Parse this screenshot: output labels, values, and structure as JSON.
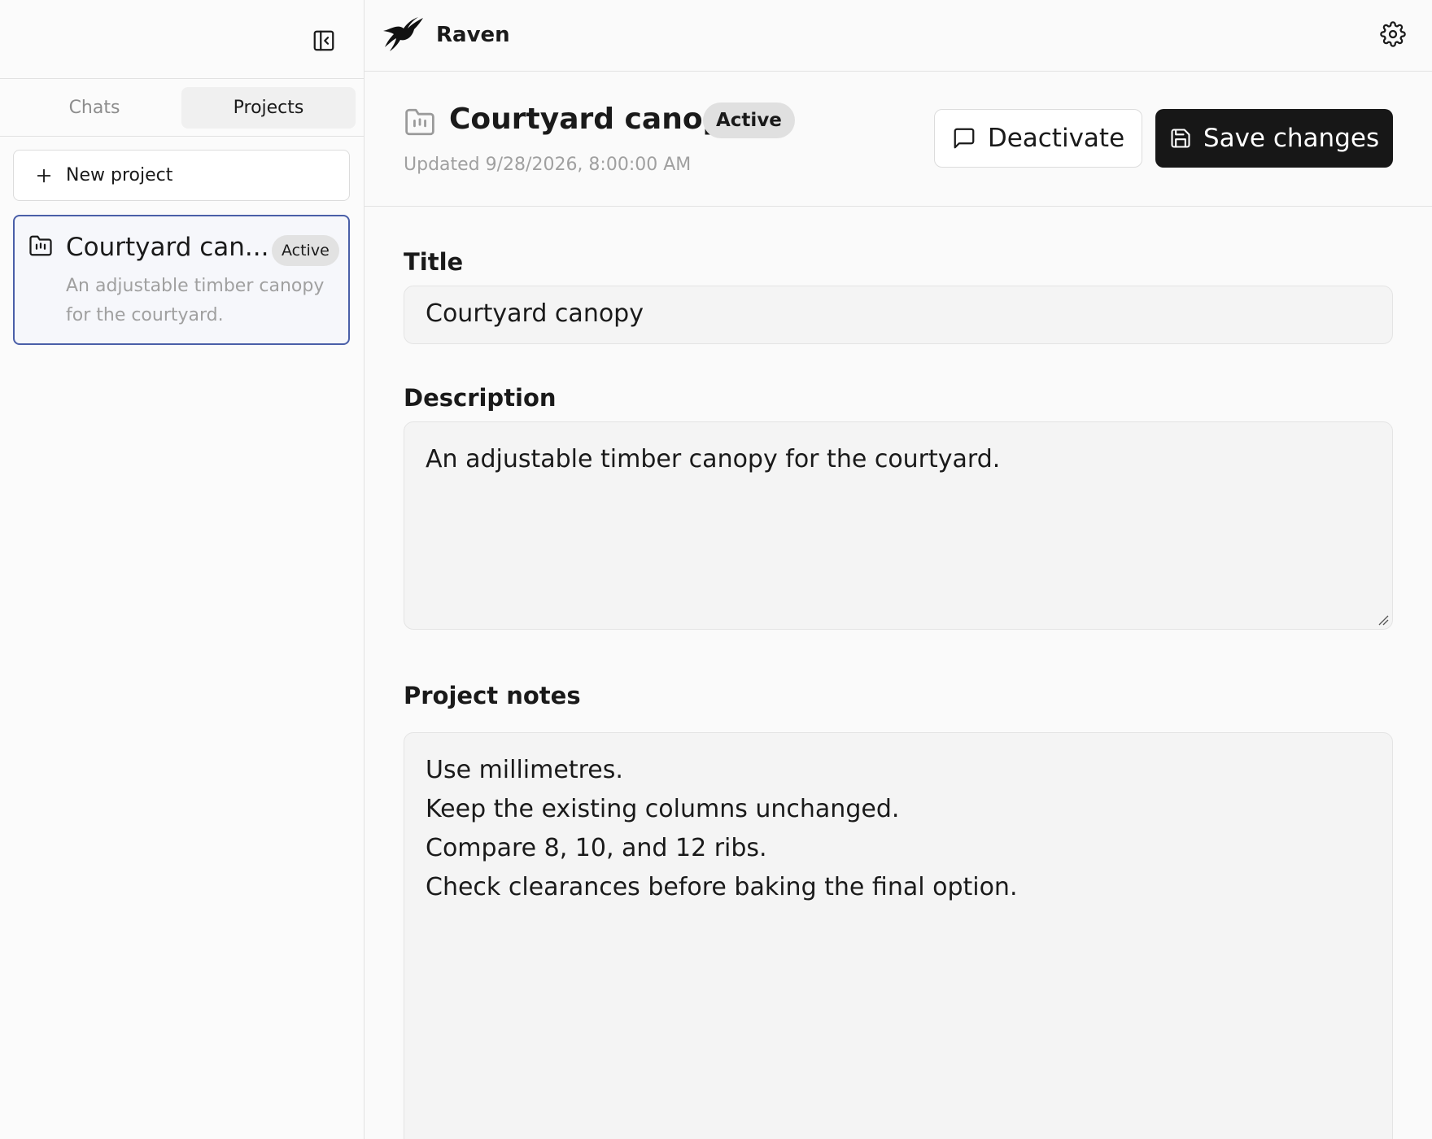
{
  "sidebar": {
    "tabs": [
      {
        "label": "Chats",
        "active": false
      },
      {
        "label": "Projects",
        "active": true
      }
    ],
    "new_project_label": "New project",
    "project": {
      "title": "Courtyard can...",
      "badge": "Active",
      "description": "An adjustable timber canopy for the courtyard."
    }
  },
  "topbar": {
    "brand": "Raven"
  },
  "header": {
    "title": "Courtyard canopy",
    "badge": "Active",
    "updated": "Updated 9/28/2026, 8:00:00 AM",
    "deactivate_label": "Deactivate",
    "save_label": "Save changes"
  },
  "form": {
    "title_label": "Title",
    "title_value": "Courtyard canopy",
    "description_label": "Description",
    "description_value": "An adjustable timber canopy for the courtyard.",
    "notes_label": "Project notes",
    "notes_value": "Use millimetres.\nKeep the existing columns unchanged.\nCompare 8, 10, and 12 ribs.\nCheck clearances before baking the final option."
  },
  "colors": {
    "accent_border": "#4a5fa8",
    "primary_button": "#171717",
    "badge_bg": "#e0e0e0"
  }
}
